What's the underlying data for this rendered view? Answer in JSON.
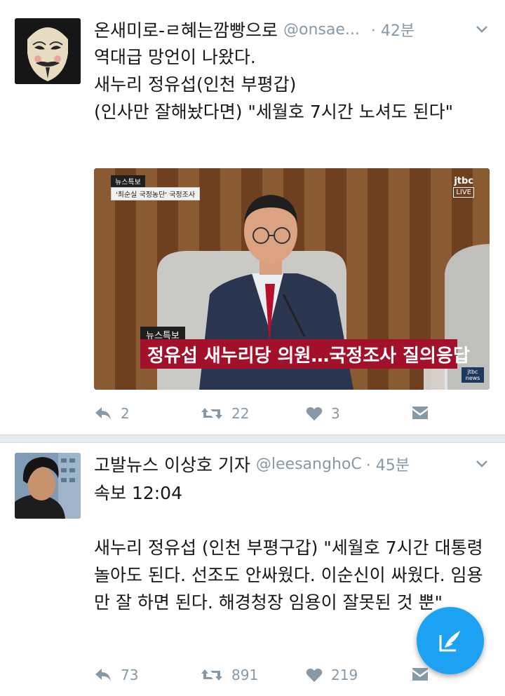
{
  "tweets": [
    {
      "name": "온새미로-ㄹ혜는깜빵으로",
      "handle": "@onsae...",
      "time": "· 42분",
      "text": "역대급 망언이 나왔다.\n새누리 정유섭(인천 부평갑)\n(인사만 잘해놨다면) \"세월호 7시간 노셔도 된다\"",
      "media": {
        "bug_top": "뉴스특보",
        "bug_sub": "'최순실 국정농단' 국정조사",
        "logo": "jtbc",
        "logo_live": "LIVE",
        "lower_third_top": "뉴스특보",
        "lower_third": "정유섭 새누리당 의원…국정조사 질의응답",
        "corner_logo": "jtbc news"
      },
      "replies": "2",
      "retweets": "22",
      "likes": "3"
    },
    {
      "name": "고발뉴스 이상호 기자",
      "handle": "@leesanghoC",
      "time": "· 45분",
      "text": "속보 12:04\n\n새누리 정유섭 (인천 부평구갑) \"세월호 7시간 대통령 놀아도 된다. 선조도 안싸웠다. 이순신이 싸웠다. 임용만 잘 하면 된다. 해경청장 임용이 잘못된 것 뿐\"",
      "replies": "73",
      "retweets": "891",
      "likes": "219"
    }
  ],
  "colors": {
    "accent": "#1da1f2",
    "meta": "#8899a6",
    "divider": "#e6ecf0",
    "chyron": "#a3102a"
  },
  "icons": {
    "reply": "reply-icon",
    "retweet": "retweet-icon",
    "like": "heart-icon",
    "dm": "envelope-icon",
    "compose": "compose-icon",
    "caret": "chevron-down-icon"
  }
}
